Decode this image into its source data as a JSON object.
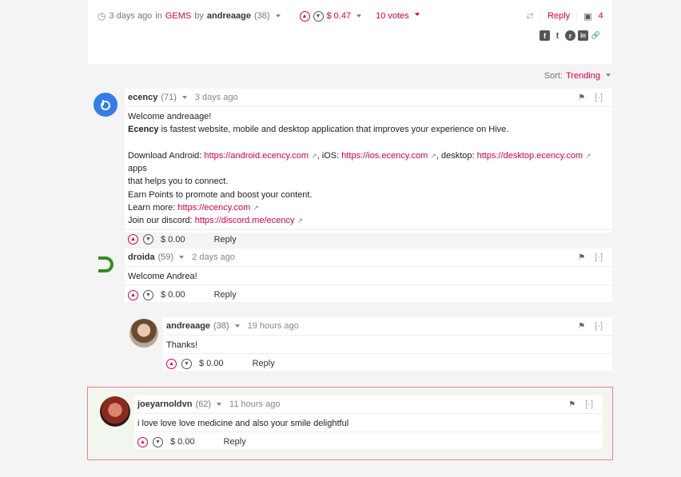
{
  "post": {
    "time_ago": "3 days ago",
    "in_text": "in",
    "community": "GEMS",
    "by_text": "by",
    "author": "andreaage",
    "author_rep": "(38)",
    "payout": "$ 0.47",
    "votes": "10 votes",
    "reply_label": "Reply",
    "comment_count": "4"
  },
  "share": {
    "facebook": "f",
    "twitter": "t",
    "reddit": "r",
    "linkedin": "in",
    "link": "🔗"
  },
  "sort": {
    "label": "Sort:",
    "value": "Trending"
  },
  "comments": [
    {
      "author": "ecency",
      "rep": "(71)",
      "time": "3 days ago",
      "lines": {
        "l1": "Welcome andreaage!",
        "l2_bold": "Ecency",
        "l2_rest": " is fastest website, mobile and desktop application that improves your experience on Hive.",
        "l3_a": "Download Android: ",
        "l3_link1": "https://android.ecency.com",
        "l3_b": ", iOS: ",
        "l3_link2": "https://ios.ecency.com",
        "l3_c": ", desktop: ",
        "l3_link3": "https://desktop.ecency.com",
        "l3_d": " apps",
        "l4": "that helps you to connect.",
        "l5": "Earn Points to promote and boost your content.",
        "l6_a": "Learn more: ",
        "l6_link": "https://ecency.com",
        "l7_a": "Join our discord: ",
        "l7_link": "https://discord.me/ecency"
      },
      "payout": "$ 0.00",
      "reply": "Reply"
    },
    {
      "author": "droida",
      "rep": "(59)",
      "time": "2 days ago",
      "text": "Welcome Andrea!",
      "payout": "$ 0.00",
      "reply": "Reply"
    },
    {
      "author": "andreaage",
      "rep": "(38)",
      "time": "19 hours ago",
      "text": "Thanks!",
      "payout": "$ 0.00",
      "reply": "Reply"
    },
    {
      "author": "joeyarnoldvn",
      "rep": "(62)",
      "time": "11 hours ago",
      "text": "i love love love medicine and also your smile delightful",
      "payout": "$ 0.00",
      "reply": "Reply"
    }
  ],
  "collapse_label": "[-]",
  "colors": {
    "accent": "#d1004a",
    "highlight_border": "#e87f9e",
    "ecency_blue": "#357ce6",
    "droida_green": "#3d8b1f"
  }
}
